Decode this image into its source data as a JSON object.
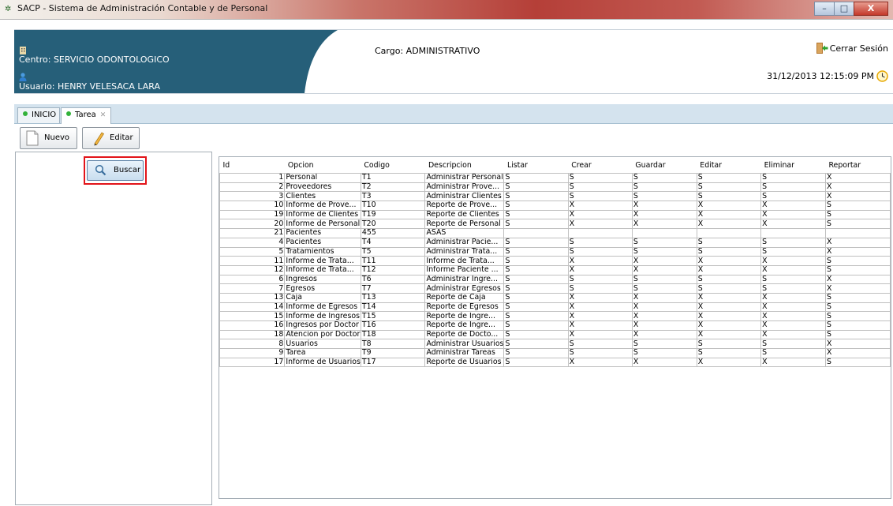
{
  "window": {
    "title": "SACP - Sistema de Administración Contable y de Personal",
    "controls": {
      "minimize": "–",
      "maximize": "□",
      "close": "X"
    }
  },
  "header": {
    "centro": "Centro: SERVICIO ODONTOLOGICO",
    "usuario": "Usuario: HENRY VELESACA LARA",
    "cargo": "Cargo:  ADMINISTRATIVO",
    "logout_label": "Cerrar Sesión",
    "datetime": "31/12/2013 12:15:09 PM",
    "band_color": "#265f79"
  },
  "tabs": [
    {
      "label": "INICIO",
      "active": false,
      "closable": false
    },
    {
      "label": "Tarea",
      "active": true,
      "closable": true
    }
  ],
  "toolbar": {
    "new_label": "Nuevo",
    "edit_label": "Editar",
    "new_icon": "document-icon",
    "edit_icon": "pencil-icon"
  },
  "search": {
    "label": "Buscar",
    "icon": "magnifier-icon",
    "highlight_color": "#e2141a"
  },
  "table": {
    "columns": [
      "Id",
      "Opcion",
      "Codigo",
      "Descripcion",
      "Listar",
      "Crear",
      "Guardar",
      "Editar",
      "Eliminar",
      "Reportar"
    ],
    "rows": [
      [
        "1",
        "Personal",
        "T1",
        "Administrar Personal",
        "S",
        "S",
        "S",
        "S",
        "S",
        "X"
      ],
      [
        "2",
        "Proveedores",
        "T2",
        "Administrar Prove...",
        "S",
        "S",
        "S",
        "S",
        "S",
        "X"
      ],
      [
        "3",
        "Clientes",
        "T3",
        "Administrar Clientes",
        "S",
        "S",
        "S",
        "S",
        "S",
        "X"
      ],
      [
        "10",
        "Informe de Prove...",
        "T10",
        "Reporte de Prove...",
        "S",
        "X",
        "X",
        "X",
        "X",
        "S"
      ],
      [
        "19",
        "Informe de Clientes",
        "T19",
        "Reporte de Clientes",
        "S",
        "X",
        "X",
        "X",
        "X",
        "S"
      ],
      [
        "20",
        "Informe de Personal",
        "T20",
        "Reporte de Personal",
        "S",
        "X",
        "X",
        "X",
        "X",
        "S"
      ],
      [
        "21",
        "Pacientes",
        "455",
        "ASAS",
        "",
        "",
        "",
        "",
        "",
        ""
      ],
      [
        "4",
        "Pacientes",
        "T4",
        "Administrar Pacie...",
        "S",
        "S",
        "S",
        "S",
        "S",
        "X"
      ],
      [
        "5",
        "Tratamientos",
        "T5",
        "Administrar Trata...",
        "S",
        "S",
        "S",
        "S",
        "S",
        "X"
      ],
      [
        "11",
        "Informe de Trata...",
        "T11",
        "Informe de Trata...",
        "S",
        "X",
        "X",
        "X",
        "X",
        "S"
      ],
      [
        "12",
        "Informe de Trata...",
        "T12",
        "Informe Paciente ...",
        "S",
        "X",
        "X",
        "X",
        "X",
        "S"
      ],
      [
        "6",
        "Ingresos",
        "T6",
        "Administrar Ingre...",
        "S",
        "S",
        "S",
        "S",
        "S",
        "X"
      ],
      [
        "7",
        "Egresos",
        "T7",
        "Administrar Egresos",
        "S",
        "S",
        "S",
        "S",
        "S",
        "X"
      ],
      [
        "13",
        "Caja",
        "T13",
        "Reporte de Caja",
        "S",
        "X",
        "X",
        "X",
        "X",
        "S"
      ],
      [
        "14",
        "Informe de Egresos",
        "T14",
        "Reporte de Egresos",
        "S",
        "X",
        "X",
        "X",
        "X",
        "S"
      ],
      [
        "15",
        "Informe de Ingresos",
        "T15",
        "Reporte de Ingre...",
        "S",
        "X",
        "X",
        "X",
        "X",
        "S"
      ],
      [
        "16",
        "Ingresos por Doctor",
        "T16",
        "Reporte de Ingre...",
        "S",
        "X",
        "X",
        "X",
        "X",
        "S"
      ],
      [
        "18",
        "Atencion por Doctor",
        "T18",
        "Reporte de Docto...",
        "S",
        "X",
        "X",
        "X",
        "X",
        "S"
      ],
      [
        "8",
        "Usuarios",
        "T8",
        "Administrar Usuarios",
        "S",
        "S",
        "S",
        "S",
        "S",
        "X"
      ],
      [
        "9",
        "Tarea",
        "T9",
        "Administrar Tareas",
        "S",
        "S",
        "S",
        "S",
        "S",
        "X"
      ],
      [
        "17",
        "Informe de Usuarios",
        "T17",
        "Reporte de Usuarios",
        "S",
        "X",
        "X",
        "X",
        "X",
        "S"
      ]
    ]
  }
}
